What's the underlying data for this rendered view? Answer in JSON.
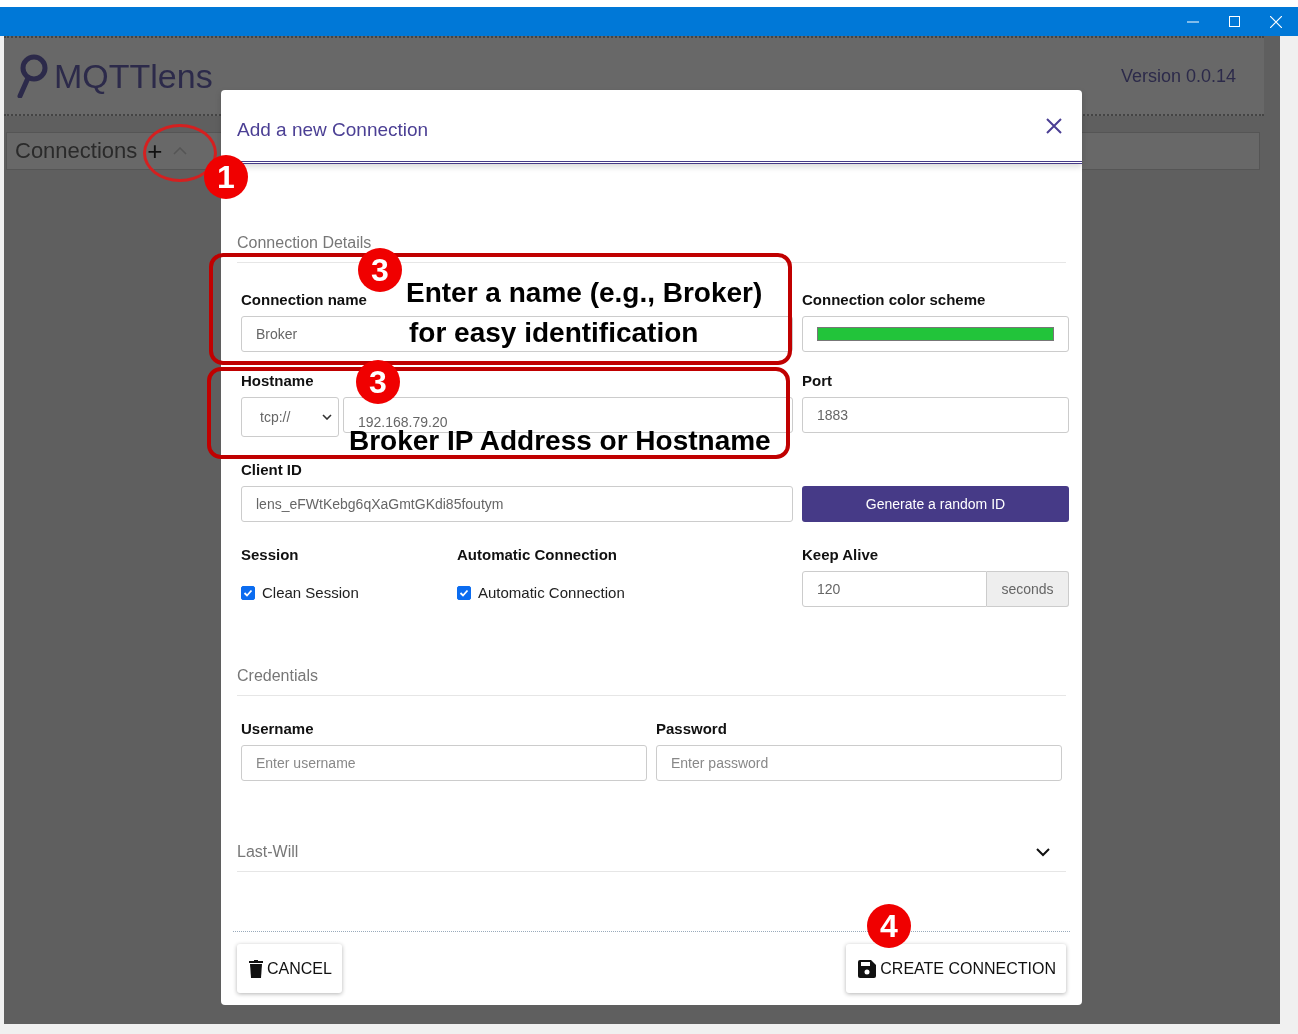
{
  "app": {
    "logo": "MQTTlens",
    "version": "Version 0.0.14",
    "connections_label": "Connections",
    "add_button": "+"
  },
  "dialog": {
    "title": "Add a new Connection",
    "details": {
      "heading": "Connection Details",
      "connection_name": {
        "label": "Connection name",
        "value": "Broker"
      },
      "color_scheme": {
        "label": "Connection color scheme",
        "color": "#22c43a"
      },
      "hostname": {
        "label": "Hostname",
        "protocol": "tcp://",
        "value": "192.168.79.20"
      },
      "port": {
        "label": "Port",
        "value": "1883"
      },
      "client_id": {
        "label": "Client ID",
        "value": "lens_eFWtKebg6qXaGmtGKdi85foutym"
      },
      "generate_button": "Generate a random ID",
      "session": {
        "label": "Session",
        "checkbox": "Clean Session",
        "checked": true
      },
      "auto": {
        "label": "Automatic Connection",
        "checkbox": "Automatic Connection",
        "checked": true
      },
      "keep_alive": {
        "label": "Keep Alive",
        "value": "120",
        "unit": "seconds"
      }
    },
    "credentials": {
      "heading": "Credentials",
      "username": {
        "label": "Username",
        "placeholder": "Enter username"
      },
      "password": {
        "label": "Password",
        "placeholder": "Enter password"
      }
    },
    "last_will": {
      "heading": "Last-Will",
      "expanded": false
    },
    "buttons": [
      {
        "kind": "cancel",
        "label": "CANCEL"
      },
      {
        "kind": "create",
        "label": "CREATE CONNECTION"
      }
    ]
  },
  "annotations": [
    {
      "kind": "circle"
    },
    {
      "kind": "badge",
      "text": "1"
    },
    {
      "kind": "frame"
    },
    {
      "kind": "badge",
      "text": "3"
    },
    {
      "kind": "note",
      "text": "Enter a name (e.g., Broker)"
    },
    {
      "kind": "note",
      "text": "for easy identification"
    },
    {
      "kind": "frame"
    },
    {
      "kind": "badge",
      "text": "3"
    },
    {
      "kind": "note",
      "text": "Broker IP Address or Hostname"
    },
    {
      "kind": "badge",
      "text": "4"
    }
  ]
}
